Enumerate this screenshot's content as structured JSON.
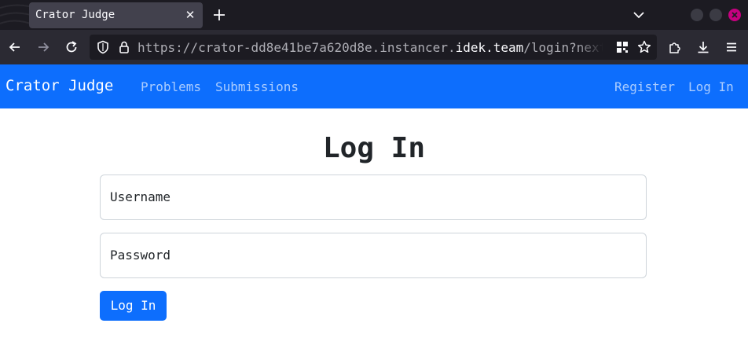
{
  "browser": {
    "tab": {
      "title": "Crator Judge",
      "close_glyph": "✕"
    },
    "url": {
      "prefix": "https://crator-dd8e41be7a620d8e.instancer.",
      "domain": "idek.team",
      "suffix": "/login?next=/"
    },
    "window_colors": {
      "close": "#c5017f",
      "toolbar": "#2b2a33",
      "tabstrip": "#1c1b22"
    }
  },
  "site": {
    "brand": "Crator Judge",
    "nav_left": [
      "Problems",
      "Submissions"
    ],
    "nav_right": [
      "Register",
      "Log In"
    ],
    "accent_color": "#0d6efd"
  },
  "login": {
    "title": "Log In",
    "username_label": "Username",
    "password_label": "Password",
    "submit_label": "Log In"
  }
}
